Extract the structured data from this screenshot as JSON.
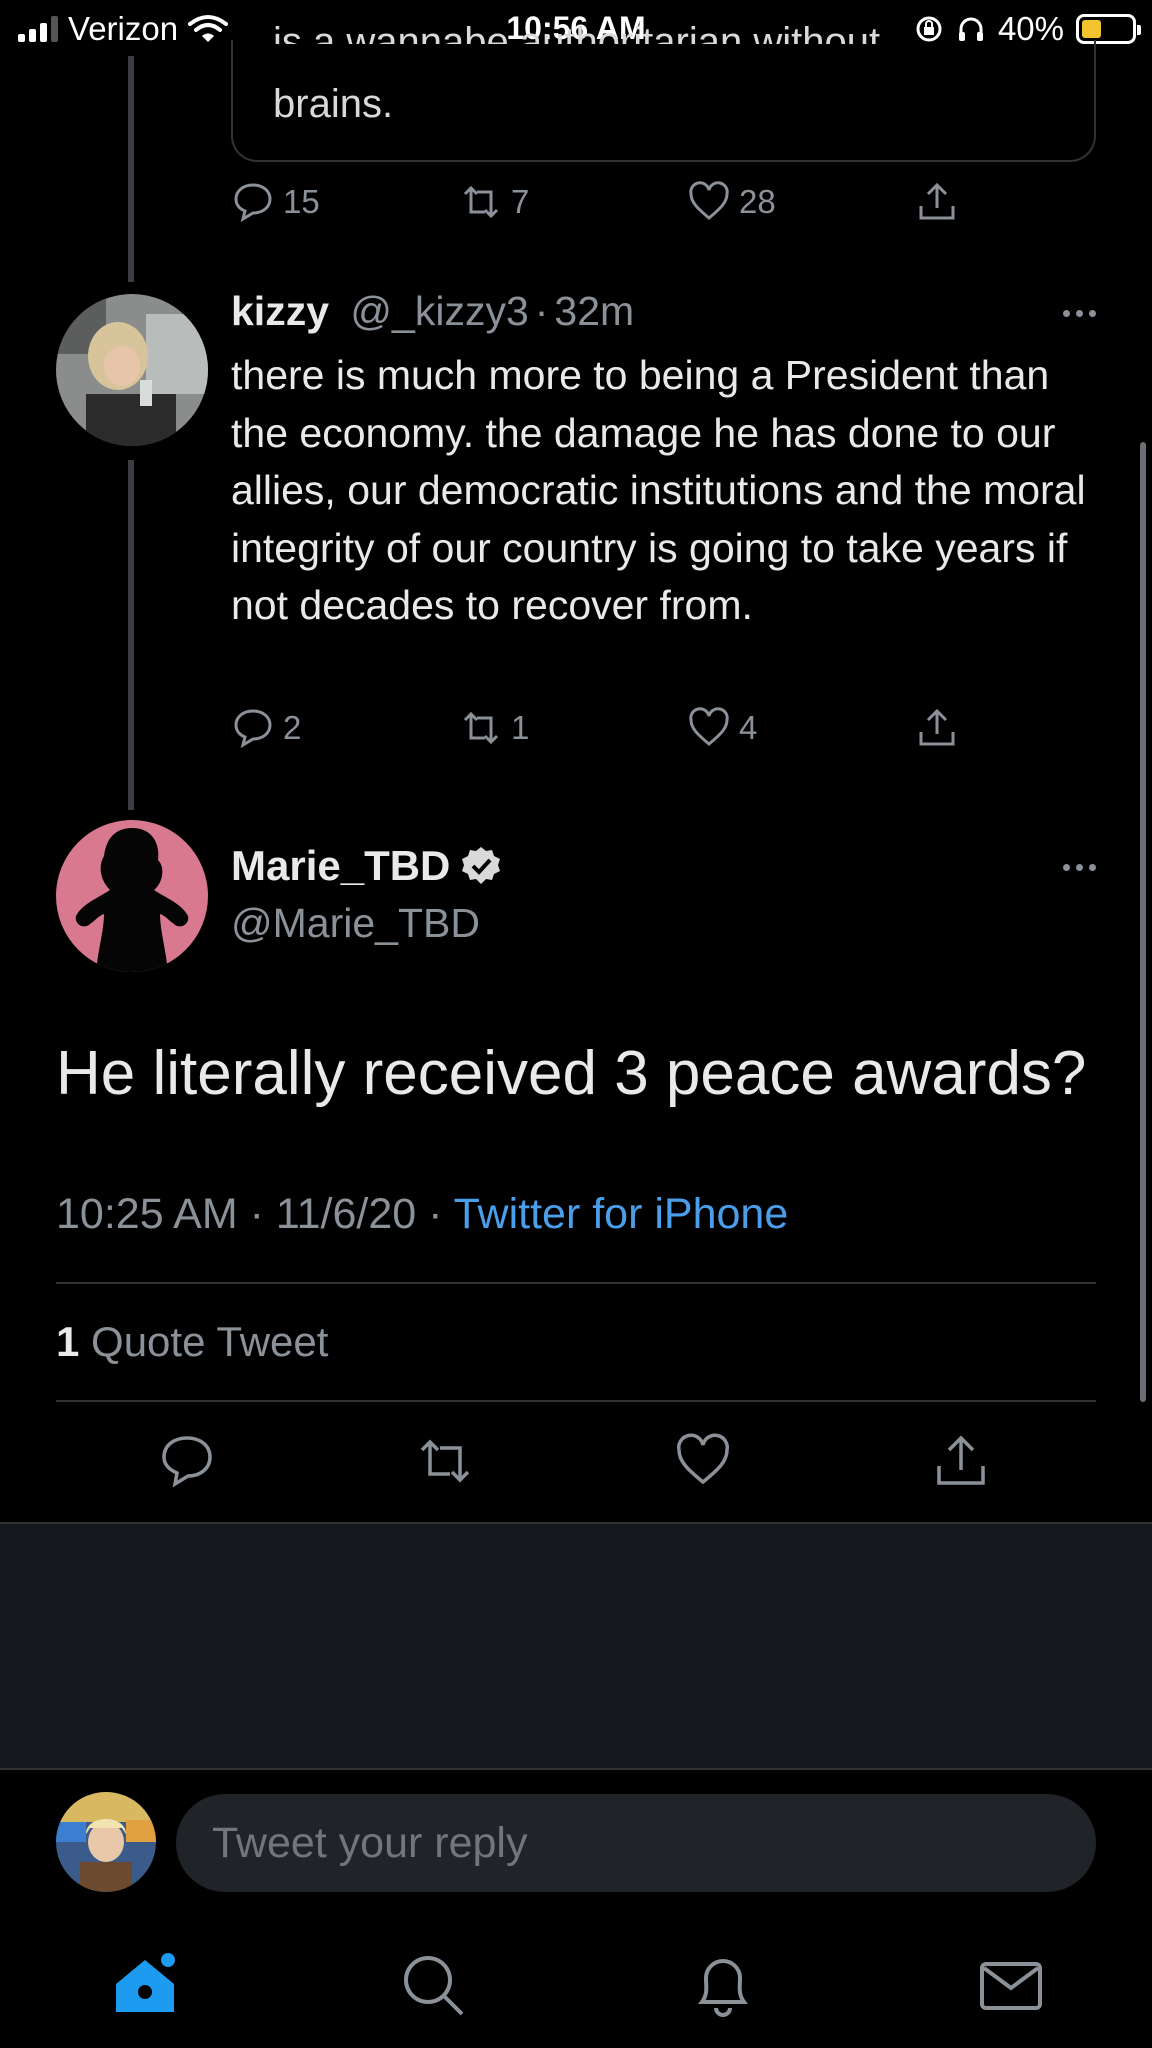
{
  "status_bar": {
    "carrier": "Verizon",
    "time": "10:56 AM",
    "battery_percent": "40%",
    "battery_level": 0.4
  },
  "quoted_tweet": {
    "cut_text": "is a wannabe authoritarian without",
    "last_line": "brains.",
    "replies": "15",
    "retweets": "7",
    "likes": "28"
  },
  "reply_tweet": {
    "name": "kizzy",
    "handle": "@_kizzy3",
    "separator": "·",
    "time_ago": "32m",
    "text": "there is much more to being a President than the economy. the damage he has done to our allies, our democratic institutions and the moral integrity of our country is going to take years if not decades to recover from.",
    "replies": "2",
    "retweets": "1",
    "likes": "4"
  },
  "main_tweet": {
    "name": "Marie_TBD",
    "handle": "@Marie_TBD",
    "text": "He literally received 3 peace awards?",
    "time": "10:25 AM",
    "date": "11/6/20",
    "separator": "·",
    "source": "Twitter for iPhone",
    "quote_count": "1",
    "quote_label": "Quote Tweet"
  },
  "reply_composer": {
    "placeholder": "Tweet your reply"
  },
  "colors": {
    "background": "#000000",
    "link_blue": "#4a9eea",
    "avatar_pink": "#d9798f",
    "secondary_text": "#8b9198"
  },
  "icons": {
    "reply": "speech-bubble-icon",
    "retweet": "retweet-arrows-icon",
    "like": "heart-icon",
    "share": "share-upload-icon",
    "more": "ellipsis-icon",
    "verified": "verified-badge-icon",
    "home": "home-icon",
    "search": "search-icon",
    "notifications": "bell-icon",
    "messages": "envelope-icon"
  }
}
